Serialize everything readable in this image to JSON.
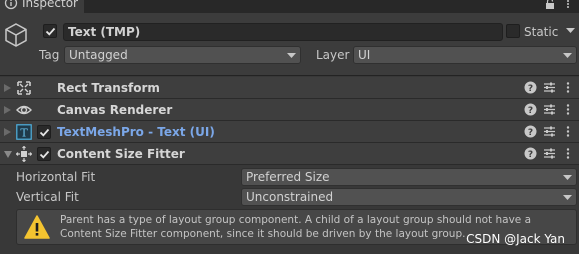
{
  "window": {
    "tab_title": "Inspector"
  },
  "gameobject": {
    "active": true,
    "name": "Text (TMP)",
    "static_label": "Static",
    "static_checked": false,
    "tag_label": "Tag",
    "tag_value": "Untagged",
    "layer_label": "Layer",
    "layer_value": "UI"
  },
  "components": [
    {
      "title": "Rect Transform",
      "icon": "rect-transform-icon",
      "has_checkbox": false,
      "expanded": false
    },
    {
      "title": "Canvas Renderer",
      "icon": "eye-icon",
      "has_checkbox": false,
      "expanded": false
    },
    {
      "title": "TextMeshPro - Text (UI)",
      "icon": "textmeshpro-icon",
      "has_checkbox": true,
      "expanded": false
    },
    {
      "title": "Content Size Fitter",
      "icon": "content-size-fitter-icon",
      "has_checkbox": true,
      "expanded": true
    }
  ],
  "content_size_fitter": {
    "horizontal_fit_label": "Horizontal Fit",
    "horizontal_fit_value": "Preferred Size",
    "vertical_fit_label": "Vertical Fit",
    "vertical_fit_value": "Unconstrained",
    "warning_text": "Parent has a type of layout group component. A child of a layout group should not have a Content Size Fitter component, since it should be driven by the layout group."
  },
  "watermark": "CSDN @Jack Yan",
  "colors": {
    "background": "#383838",
    "header": "#3c3c3c",
    "field": "#2a2a2a",
    "dropdown": "#515151",
    "link_blue": "#7ba7e8",
    "warning_yellow": "#f4c430"
  }
}
